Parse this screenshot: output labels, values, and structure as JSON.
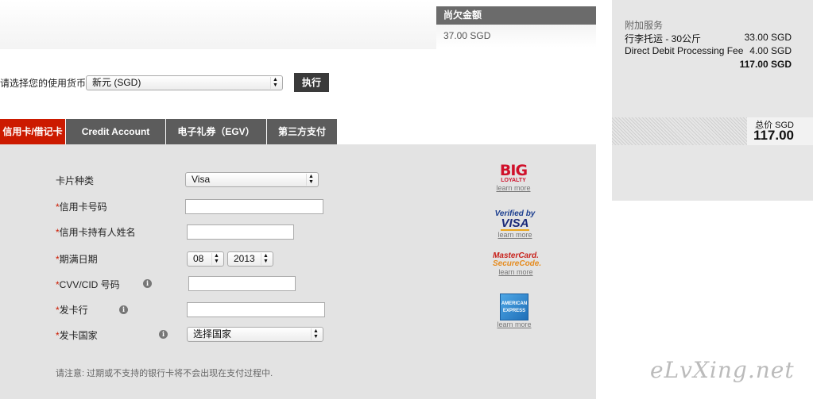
{
  "owed": {
    "label": "尚欠金额",
    "value": "37.00 SGD"
  },
  "currency": {
    "label": "请选择您的使用货币",
    "selected": "新元 (SGD)",
    "button": "执行"
  },
  "tabs": [
    {
      "label": "信用卡/借记卡",
      "active": true
    },
    {
      "label": "Credit Account",
      "active": false
    },
    {
      "label": "电子礼券（EGV）",
      "active": false
    },
    {
      "label": "第三方支付",
      "active": false
    }
  ],
  "form": {
    "card_type": {
      "label": "卡片种类",
      "value": "Visa"
    },
    "card_number": {
      "label": "信用卡号码",
      "value": ""
    },
    "holder_name": {
      "label": "信用卡持有人姓名",
      "value": ""
    },
    "expiry": {
      "label": "期满日期",
      "month": "08",
      "year": "2013"
    },
    "cvv": {
      "label": "CVV/CID 号码",
      "value": ""
    },
    "issuer": {
      "label": "发卡行",
      "value": ""
    },
    "country": {
      "label": "发卡国家",
      "value": "选择国家"
    },
    "required_mark": "*",
    "note": "请注意:  过期或不支持的银行卡将不会出现在支付过程中."
  },
  "badges": {
    "big": {
      "logo": "BIG",
      "sub": "LOYALTY",
      "learn": "learn more"
    },
    "vbv": {
      "top": "Verified by",
      "visa": "VISA",
      "learn": "learn more"
    },
    "mastercard": {
      "top": "MasterCard.",
      "bottom": "SecureCode.",
      "learn": "learn more"
    },
    "amex": {
      "text": "AMERICAN EXPRESS",
      "learn": "learn more"
    }
  },
  "sidebar": {
    "heading": "附加服务",
    "items": [
      {
        "name": "行李托运 - 30公斤",
        "amount": "33.00 SGD"
      },
      {
        "name": "Direct Debit Processing Fee",
        "amount": "4.00 SGD"
      }
    ],
    "subtotal": "117.00 SGD",
    "total_label": "总价  SGD",
    "total_value": "117.00"
  },
  "watermark": "eLvXing.net",
  "colors": {
    "accent_red": "#cc1a00",
    "tab_gray": "#5c5c5c",
    "panel_gray": "#e3e3e3"
  }
}
